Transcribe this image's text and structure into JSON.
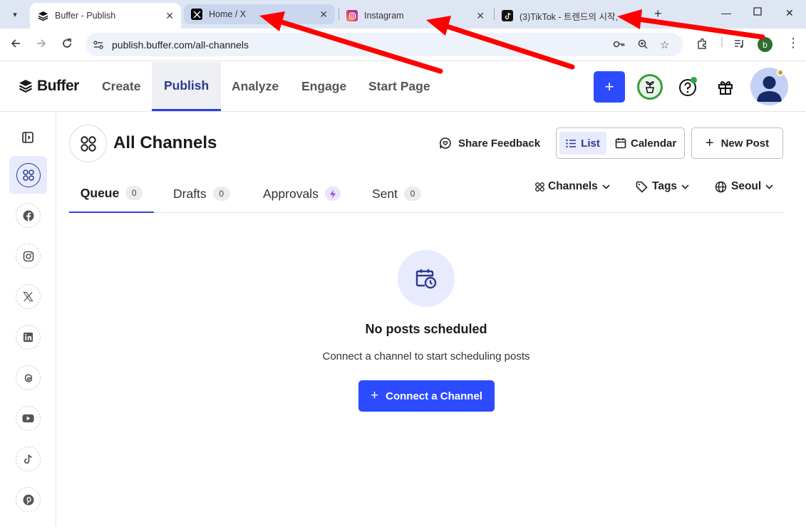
{
  "browser": {
    "tabs": [
      {
        "title": "Buffer - Publish",
        "favicon": "buffer-icon",
        "state": "active"
      },
      {
        "title": "Home / X",
        "favicon": "x-icon",
        "state": "hover"
      },
      {
        "title": "Instagram",
        "favicon": "instagram-icon",
        "state": "normal"
      },
      {
        "title": "(3)TikTok - 트렌드의 시작,",
        "favicon": "tiktok-icon",
        "state": "normal"
      }
    ],
    "url": "publish.buffer.com/all-channels",
    "profile_initial": "b"
  },
  "app": {
    "logo": "Buffer",
    "nav": [
      "Create",
      "Publish",
      "Analyze",
      "Engage",
      "Start Page"
    ],
    "active_nav": "Publish"
  },
  "sidebar": {
    "channels": [
      "facebook-icon",
      "instagram-icon",
      "x-icon",
      "linkedin-icon",
      "threads-icon",
      "youtube-icon",
      "tiktok-icon",
      "pinterest-icon"
    ]
  },
  "main": {
    "title": "All Channels",
    "share_feedback": "Share Feedback",
    "view_list": "List",
    "view_calendar": "Calendar",
    "new_post": "New Post",
    "tabs": [
      {
        "label": "Queue",
        "count": "0"
      },
      {
        "label": "Drafts",
        "count": "0"
      },
      {
        "label": "Approvals"
      },
      {
        "label": "Sent",
        "count": "0"
      }
    ],
    "filters": {
      "channels": "Channels",
      "tags": "Tags",
      "timezone": "Seoul"
    },
    "empty": {
      "title": "No posts scheduled",
      "subtitle": "Connect a channel to start scheduling posts",
      "button": "Connect a Channel"
    }
  },
  "colors": {
    "accent": "#2c4bff",
    "annotation_arrow": "#ff0000"
  }
}
